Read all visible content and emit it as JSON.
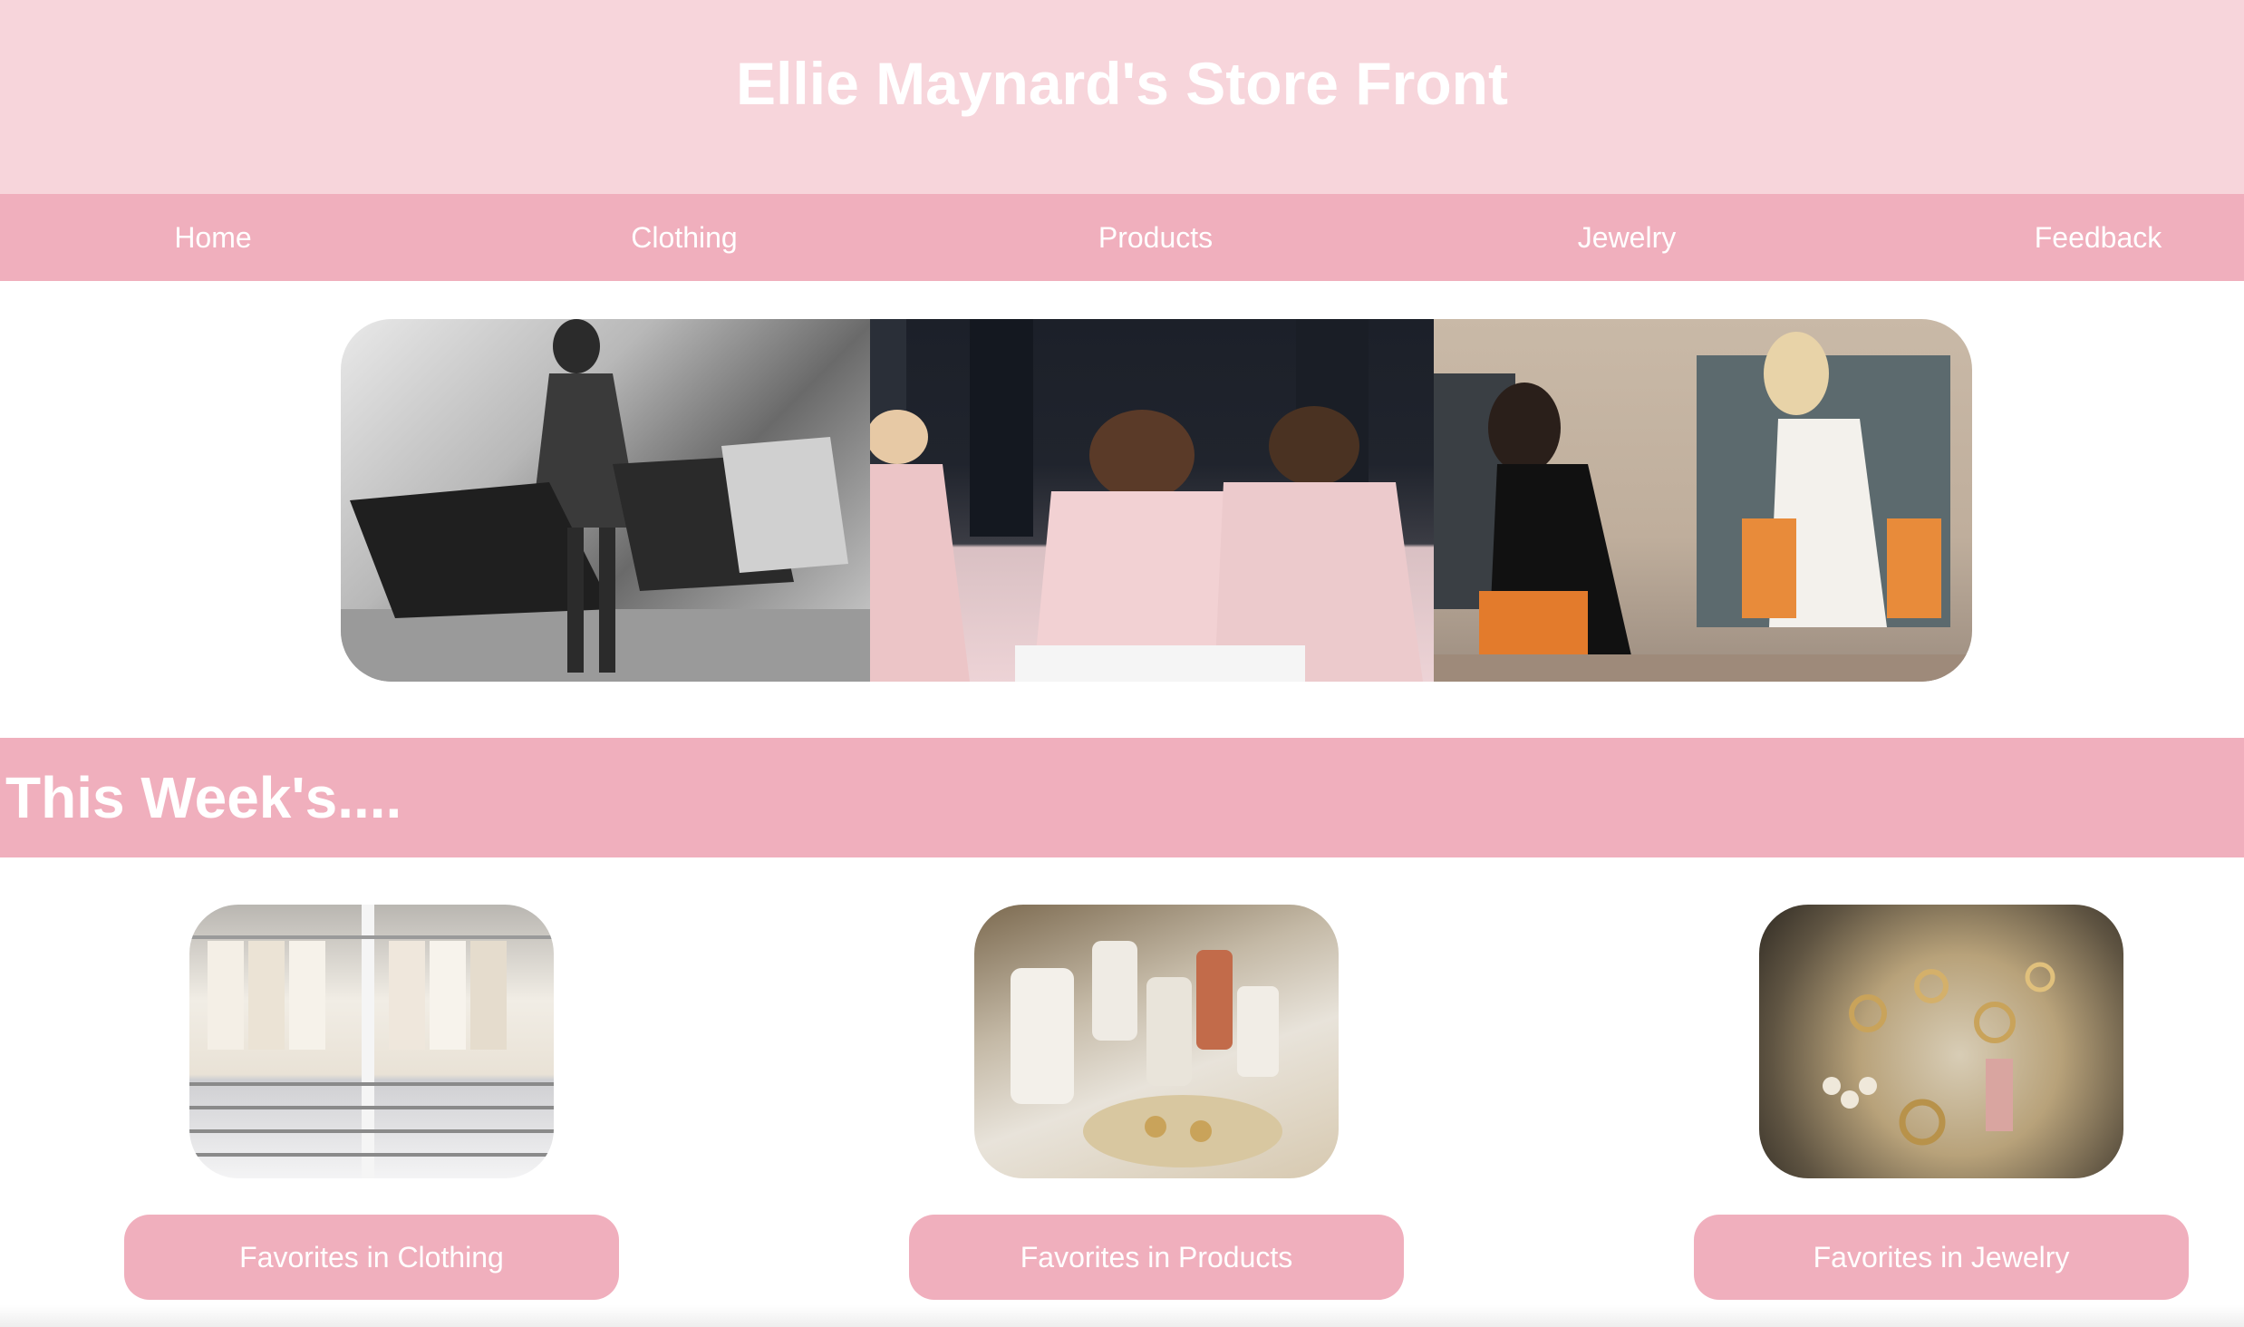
{
  "site": {
    "title": "Ellie Maynard's Store Front"
  },
  "nav": {
    "items": [
      {
        "label": "Home"
      },
      {
        "label": "Clothing"
      },
      {
        "label": "Products"
      },
      {
        "label": "Jewelry"
      },
      {
        "label": "Feedback"
      }
    ]
  },
  "hero": {
    "images": [
      "shopping-image-1",
      "shopping-image-2",
      "shopping-image-3"
    ]
  },
  "weekly": {
    "title": "This Week's....",
    "cards": [
      {
        "image": "clothing-closet-image",
        "button_label": "Favorites in Clothing"
      },
      {
        "image": "skincare-products-image",
        "button_label": "Favorites in Products"
      },
      {
        "image": "jewelry-tray-image",
        "button_label": "Favorites in Jewelry"
      }
    ]
  },
  "colors": {
    "header_bg": "#f7d5db",
    "accent_pink": "#f0afbd",
    "text_on_pink": "#ffffff"
  }
}
